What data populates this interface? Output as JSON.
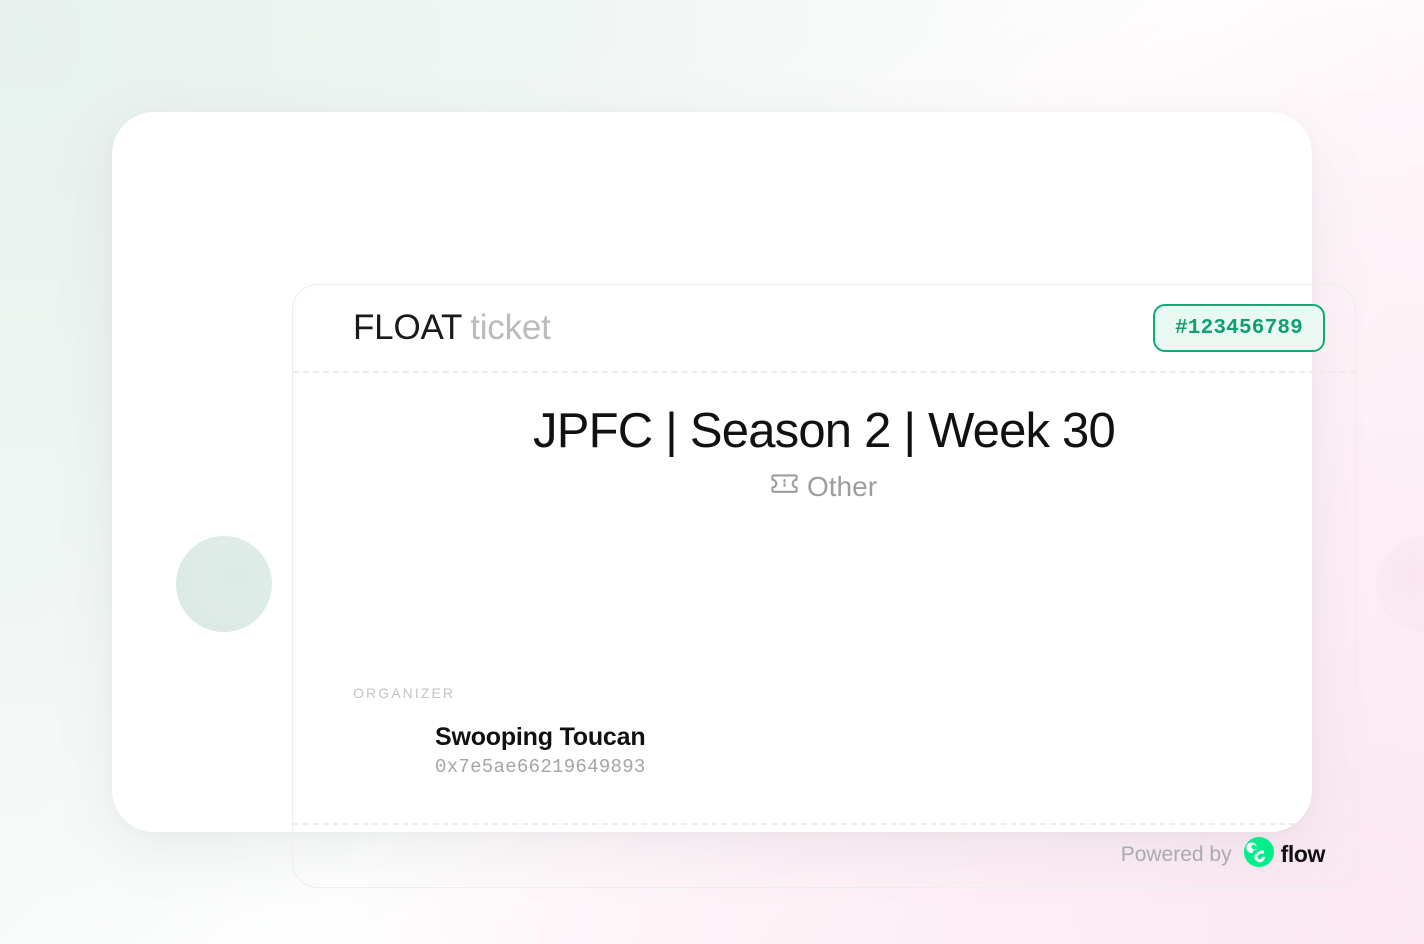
{
  "background": {
    "top_left_tint": "#e7f1ee",
    "bottom_right_tint": "#fbe8f2",
    "base": "#ffffff"
  },
  "ticket": {
    "card_background": "#ffffff",
    "inner_border_color": "#ededed",
    "header": {
      "brand_primary": "FLOAT",
      "brand_secondary": "ticket",
      "serial_number": "#123456789",
      "serial_badge_background": "#e9f8f1",
      "serial_badge_border": "#12a87a",
      "serial_badge_text_color": "#0f9f73"
    },
    "event": {
      "title": "JPFC | Season 2 | Week 30",
      "type_label": "Other",
      "type_icon": "ticket-icon",
      "type_text_color": "#9d9d9d"
    },
    "organizer": {
      "section_label": "ORGANIZER",
      "name": "Swooping Toucan",
      "address": "0x7e5ae66219649893"
    },
    "footer": {
      "powered_by_text": "Powered by",
      "brand_name": "flow",
      "brand_icon": "flow-logo-icon",
      "brand_accent_color": "#00ef8b"
    },
    "notches": {
      "left_fill": "#dfece7",
      "right_fill": "#fbeaf3"
    }
  }
}
